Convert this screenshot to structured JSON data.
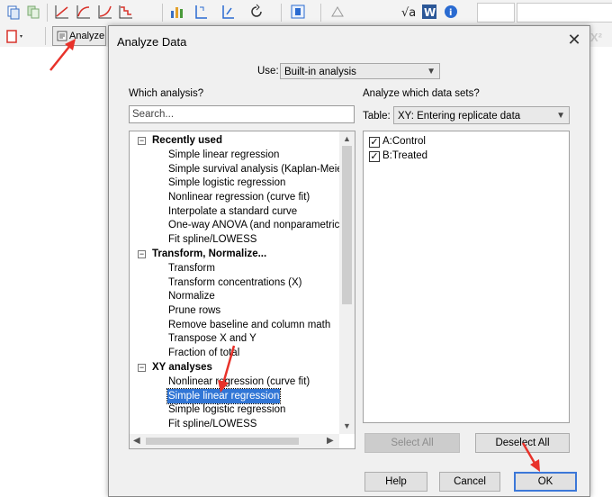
{
  "toolbar": {
    "icons": [
      "copy-icon",
      "paste-icon",
      "graph-linear-icon",
      "graph-log-icon",
      "graph-exp-icon",
      "graph-cumulative-icon",
      "analyze-chart-icon",
      "transform-icon",
      "normalize-icon",
      "refresh-icon",
      "sheet-icon",
      "chart-style-icon",
      "math-icon",
      "word-icon",
      "info-icon"
    ],
    "analyze_label": "Analyze"
  },
  "dialog": {
    "title": "Analyze Data",
    "use_label": "Use:",
    "use_value": "Built-in analysis",
    "which_analysis_label": "Which analysis?",
    "search_placeholder": "Search...",
    "data_sets_label": "Analyze which data sets?",
    "table_label": "Table:",
    "table_value": "XY: Entering replicate data",
    "groups": [
      {
        "name": "Recently used",
        "items": [
          "Simple linear regression",
          "Simple survival analysis (Kaplan-Meier)",
          "Simple logistic regression",
          "Nonlinear regression (curve fit)",
          "Interpolate a standard curve",
          "One-way ANOVA (and nonparametric or",
          "Fit spline/LOWESS"
        ]
      },
      {
        "name": "Transform, Normalize...",
        "items": [
          "Transform",
          "Transform concentrations (X)",
          "Normalize",
          "Prune rows",
          "Remove baseline and column math",
          "Transpose X and Y",
          "Fraction of total"
        ]
      },
      {
        "name": "XY analyses",
        "items": [
          "Nonlinear regression (curve fit)",
          "Simple linear regression",
          "Simple logistic regression",
          "Fit spline/LOWESS"
        ]
      }
    ],
    "selected_item": "Simple linear regression",
    "data_sets": [
      {
        "label": "A:Control",
        "checked": true
      },
      {
        "label": "B:Treated",
        "checked": true
      }
    ],
    "select_all_label": "Select All",
    "deselect_all_label": "Deselect All",
    "help_label": "Help",
    "cancel_label": "Cancel",
    "ok_label": "OK"
  },
  "colors": {
    "selection": "#3176d6",
    "annotation_arrow": "#e8322a",
    "ok_border": "#3c78d8"
  }
}
